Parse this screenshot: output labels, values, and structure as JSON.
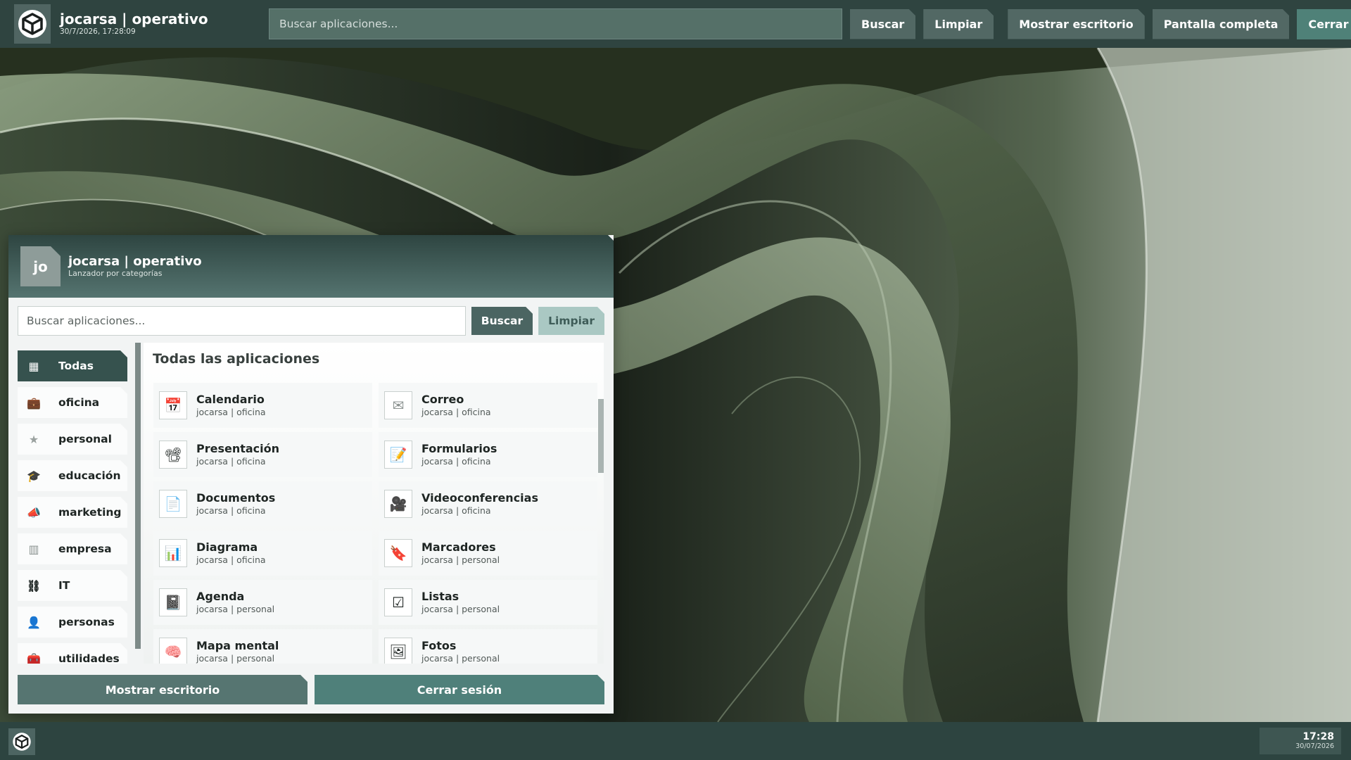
{
  "topbar": {
    "title": "jocarsa | operativo",
    "datetime": "30/7/2026, 17:28:09",
    "search_placeholder": "Buscar aplicaciones...",
    "buttons": {
      "search": "Buscar",
      "clear": "Limpiar",
      "show_desktop": "Mostrar escritorio",
      "fullscreen": "Pantalla completa",
      "logout": "Cerrar sesión"
    }
  },
  "launcher": {
    "avatar": "jo",
    "title": "jocarsa | operativo",
    "subtitle": "Lanzador por categorías",
    "search_placeholder": "Buscar aplicaciones...",
    "search_button": "Buscar",
    "clear_button": "Limpiar",
    "section_title": "Todas las aplicaciones",
    "categories": [
      {
        "label": "Todas",
        "icon": "grid-icon",
        "active": true
      },
      {
        "label": "oficina",
        "icon": "briefcase-icon"
      },
      {
        "label": "personal",
        "icon": "star-icon"
      },
      {
        "label": "educación",
        "icon": "graduation-cap-icon"
      },
      {
        "label": "marketing",
        "icon": "megaphone-icon"
      },
      {
        "label": "empresa",
        "icon": "building-icon"
      },
      {
        "label": "IT",
        "icon": "network-icon"
      },
      {
        "label": "personas",
        "icon": "person-icon"
      },
      {
        "label": "utilidades",
        "icon": "toolbox-icon"
      }
    ],
    "apps": [
      {
        "name": "Calendario",
        "sub": "jocarsa | oficina",
        "icon": "calendar-icon"
      },
      {
        "name": "Correo",
        "sub": "jocarsa | oficina",
        "icon": "envelope-icon"
      },
      {
        "name": "Presentación",
        "sub": "jocarsa | oficina",
        "icon": "projector-icon"
      },
      {
        "name": "Formularios",
        "sub": "jocarsa | oficina",
        "icon": "form-icon"
      },
      {
        "name": "Documentos",
        "sub": "jocarsa | oficina",
        "icon": "document-icon"
      },
      {
        "name": "Videoconferencias",
        "sub": "jocarsa | oficina",
        "icon": "video-camera-icon"
      },
      {
        "name": "Diagrama",
        "sub": "jocarsa | oficina",
        "icon": "bar-chart-icon"
      },
      {
        "name": "Marcadores",
        "sub": "jocarsa | personal",
        "icon": "bookmark-icon"
      },
      {
        "name": "Agenda",
        "sub": "jocarsa | personal",
        "icon": "notebook-icon"
      },
      {
        "name": "Listas",
        "sub": "jocarsa | personal",
        "icon": "checkbox-icon"
      },
      {
        "name": "Mapa mental",
        "sub": "jocarsa | personal",
        "icon": "brain-icon"
      },
      {
        "name": "Fotos",
        "sub": "jocarsa | personal",
        "icon": "photo-icon"
      }
    ],
    "footer": {
      "show_desktop": "Mostrar escritorio",
      "logout": "Cerrar sesión"
    }
  },
  "taskbar": {
    "time": "17:28",
    "date": "30/07/2026"
  },
  "colors": {
    "bar": "#2f4440",
    "accent": "#4f8178",
    "active_category": "#36524e"
  }
}
